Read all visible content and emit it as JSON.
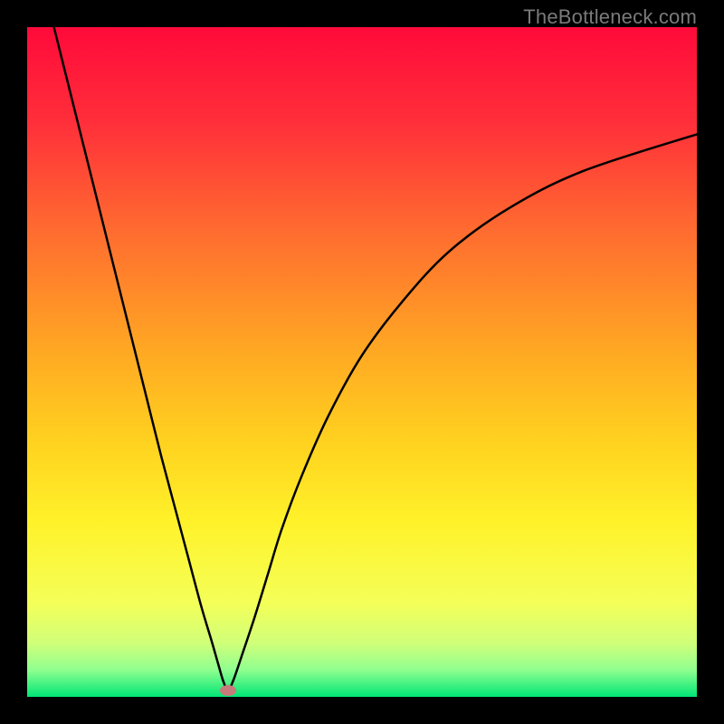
{
  "watermark": "TheBottleneck.com",
  "chart_data": {
    "type": "line",
    "title": "",
    "xlabel": "",
    "ylabel": "",
    "xlim": [
      0,
      100
    ],
    "ylim": [
      0,
      100
    ],
    "gradient_stops": [
      {
        "offset": 0.0,
        "color": "#ff0a3a"
      },
      {
        "offset": 0.14,
        "color": "#ff2e3a"
      },
      {
        "offset": 0.3,
        "color": "#ff6a30"
      },
      {
        "offset": 0.48,
        "color": "#ffa723"
      },
      {
        "offset": 0.62,
        "color": "#ffd21f"
      },
      {
        "offset": 0.74,
        "color": "#fff22a"
      },
      {
        "offset": 0.86,
        "color": "#f4ff58"
      },
      {
        "offset": 0.92,
        "color": "#d0ff7a"
      },
      {
        "offset": 0.96,
        "color": "#8fff8f"
      },
      {
        "offset": 1.0,
        "color": "#00e676"
      }
    ],
    "series": [
      {
        "name": "bottleneck-curve",
        "color": "#000000",
        "x": [
          4.0,
          6.0,
          8.0,
          10.0,
          12.0,
          14.0,
          16.0,
          18.0,
          20.0,
          22.0,
          24.0,
          26.0,
          27.5,
          28.5,
          29.3,
          30.0,
          30.8,
          32.0,
          34.0,
          36.0,
          38.0,
          41.0,
          45.0,
          50.0,
          56.0,
          63.0,
          72.0,
          83.0,
          100.0
        ],
        "y": [
          100.0,
          92.0,
          84.0,
          76.0,
          68.0,
          60.0,
          52.0,
          44.0,
          36.0,
          28.5,
          21.0,
          13.5,
          8.5,
          5.0,
          2.3,
          1.0,
          2.5,
          6.0,
          12.0,
          18.5,
          25.0,
          33.0,
          42.0,
          51.0,
          59.0,
          66.5,
          73.0,
          78.5,
          84.0
        ]
      }
    ],
    "marker": {
      "name": "minimum-marker",
      "x": 30.0,
      "y": 1.0,
      "color": "#c77b7b"
    },
    "background": "#000000",
    "grid": false,
    "legend": false
  }
}
